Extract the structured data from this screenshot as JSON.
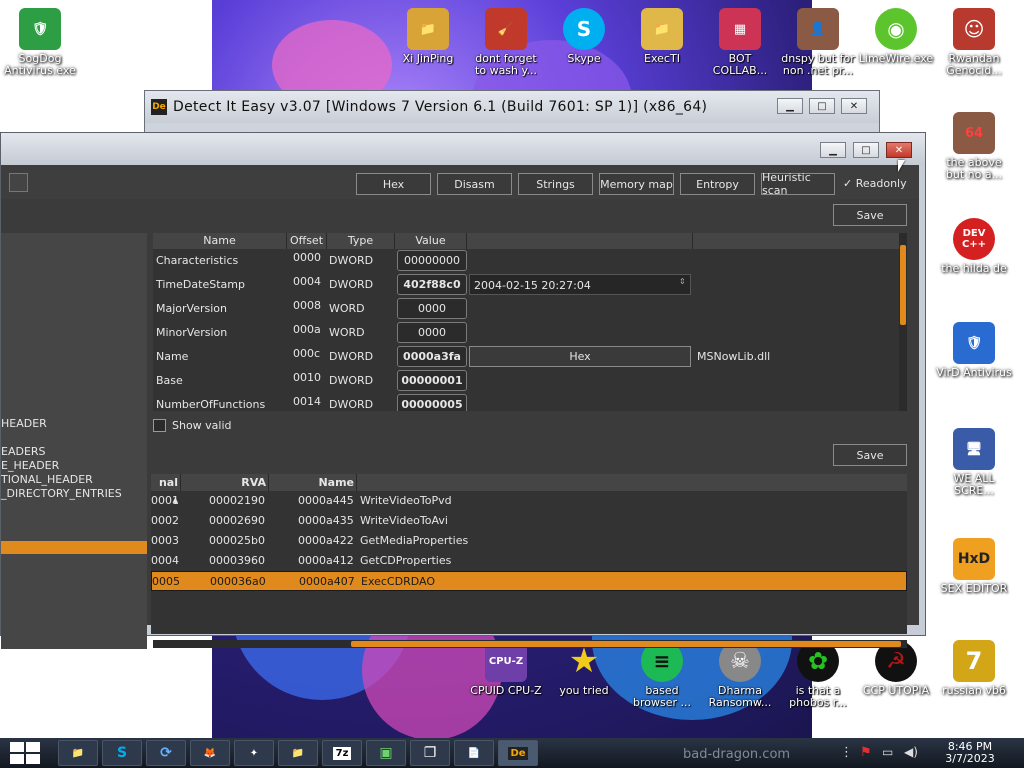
{
  "desktop": {
    "icons": [
      {
        "label": "SogDog Antivirus.exe",
        "color": "#2e9e44",
        "glyph": "🛡"
      },
      {
        "label": "Xi JinPing",
        "color": "#d8a437",
        "glyph": "📁"
      },
      {
        "label": "dont forget to wash y...",
        "color": "#c0392b",
        "glyph": "🧹"
      },
      {
        "label": "Skype",
        "color": "#00aff0",
        "glyph": "S"
      },
      {
        "label": "ExecTI",
        "color": "#e0b84a",
        "glyph": "📁"
      },
      {
        "label": "BOT COLLAB...",
        "color": "#cc3355",
        "glyph": "▦"
      },
      {
        "label": "dnspy but for non .net pr...",
        "color": "#8a5a44",
        "glyph": "👤"
      },
      {
        "label": "LimeWire.exe",
        "color": "#5cc52e",
        "glyph": "◉"
      },
      {
        "label": "Rwandan Genocid...",
        "color": "#b83a2e",
        "glyph": "☺"
      },
      {
        "label": "the above but no a...",
        "color": "#8a5a44",
        "glyph": "64"
      },
      {
        "label": "the hilda de",
        "color": "#d42020",
        "glyph": "DEV C++"
      },
      {
        "label": "VirD Antivirus",
        "color": "#2a6bd1",
        "glyph": "🛡"
      },
      {
        "label": "WE ALL SCRE...",
        "color": "#3a5ca8",
        "glyph": "🖥"
      },
      {
        "label": "SEX EDITOR",
        "color": "#f0a020",
        "glyph": "HxD"
      },
      {
        "label": "russian vb6",
        "color": "#d2a616",
        "glyph": "7"
      },
      {
        "label": "CPUID CPU-Z",
        "color": "#6e3fa8",
        "glyph": "CPU-Z"
      },
      {
        "label": "you tried",
        "color": "#f2cc1a",
        "glyph": "★"
      },
      {
        "label": "based browser ...",
        "color": "#1db954",
        "glyph": "≡"
      },
      {
        "label": "Dharma Ransomw...",
        "color": "#888888",
        "glyph": "☠"
      },
      {
        "label": "is that a phobos r...",
        "color": "#26c21e",
        "glyph": "✿"
      },
      {
        "label": "CCP UTOPIA",
        "color": "#b01818",
        "glyph": "☭"
      }
    ]
  },
  "back_window": {
    "app_tag": "De",
    "title": "Detect It Easy v3.07 [Windows 7 Version 6.1 (Build 7601: SP 1)] (x86_64)"
  },
  "front_window": {
    "toolbar": {
      "buttons": [
        "Hex",
        "Disasm",
        "Strings",
        "Memory map",
        "Entropy",
        "Heuristic scan"
      ],
      "readonly_label": "✓  Readonly",
      "save_top": "Save"
    },
    "tree": {
      "items": [
        "HEADER",
        "EADERS",
        "E_HEADER",
        "TIONAL_HEADER",
        "_DIRECTORY_ENTRIES"
      ]
    },
    "header_table": {
      "columns": [
        "Name",
        "Offset",
        "Type",
        "Value"
      ],
      "rows": [
        {
          "name": "Characteristics",
          "offset": "0000",
          "type": "DWORD",
          "value": "00000000"
        },
        {
          "name": "TimeDateStamp",
          "offset": "0004",
          "type": "DWORD",
          "value": "402f88c0",
          "extra": "2004-02-15 20:27:04"
        },
        {
          "name": "MajorVersion",
          "offset": "0008",
          "type": "WORD",
          "value": "0000"
        },
        {
          "name": "MinorVersion",
          "offset": "000a",
          "type": "WORD",
          "value": "0000"
        },
        {
          "name": "Name",
          "offset": "000c",
          "type": "DWORD",
          "value": "0000a3fa",
          "button": "Hex",
          "extra": "MSNowLib.dll"
        },
        {
          "name": "Base",
          "offset": "0010",
          "type": "DWORD",
          "value": "00000001"
        },
        {
          "name": "NumberOfFunctions",
          "offset": "0014",
          "type": "DWORD",
          "value": "00000005"
        }
      ]
    },
    "show_valid_label": "Show valid",
    "save_bottom": "Save",
    "export_table": {
      "columns": [
        "nal ▴",
        "RVA",
        "Name"
      ],
      "rows": [
        {
          "ordinal": "0001",
          "rva": "00002190",
          "name_rva": "0000a445",
          "name": "WriteVideoToPvd"
        },
        {
          "ordinal": "0002",
          "rva": "00002690",
          "name_rva": "0000a435",
          "name": "WriteVideoToAvi"
        },
        {
          "ordinal": "0003",
          "rva": "000025b0",
          "name_rva": "0000a422",
          "name": "GetMediaProperties"
        },
        {
          "ordinal": "0004",
          "rva": "00003960",
          "name_rva": "0000a412",
          "name": "GetCDProperties"
        },
        {
          "ordinal": "0005",
          "rva": "000036a0",
          "name_rva": "0000a407",
          "name": "ExecCDRDAO"
        }
      ],
      "selected_index": 4
    }
  },
  "taskbar": {
    "apps": [
      "📁",
      "S",
      "⟳",
      "🦊",
      "✦",
      "📁",
      "7z",
      "▣",
      "❐",
      "📄",
      "De"
    ],
    "watermark": "bad-dragon.com",
    "time": "8:46 PM",
    "date": "3/7/2023"
  },
  "colors": {
    "accent": "#e08a1e",
    "panel": "#3b3b3b"
  }
}
